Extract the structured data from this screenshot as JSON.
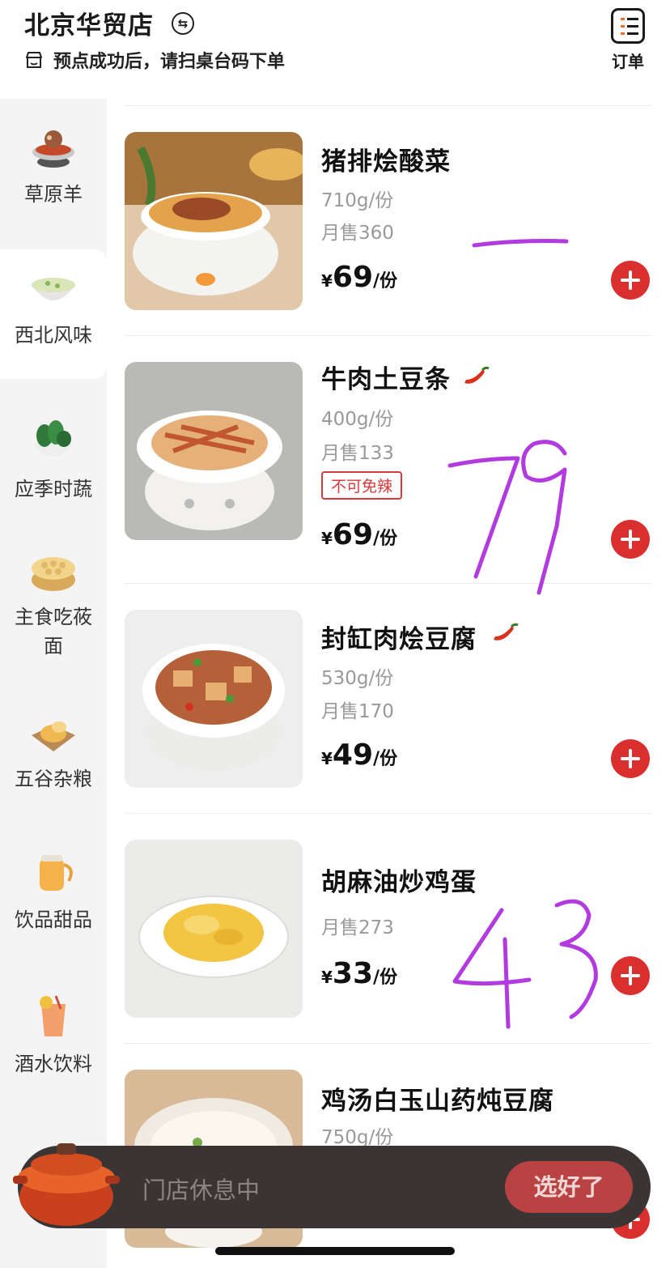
{
  "header": {
    "store_name": "北京华贸店",
    "notice": "预点成功后，请扫桌台码下单",
    "order_label": "订单"
  },
  "sidebar": {
    "items": [
      {
        "label": "草原羊",
        "icon": "lamb-hotpot-icon"
      },
      {
        "label": "西北风味",
        "icon": "soup-bowl-icon",
        "active": true
      },
      {
        "label": "应季时蔬",
        "icon": "vegetable-bowl-icon"
      },
      {
        "label": "主食吃莜面",
        "icon": "steamer-icon"
      },
      {
        "label": "五谷杂粮",
        "icon": "grain-snack-icon"
      },
      {
        "label": "饮品甜品",
        "icon": "teapot-icon"
      },
      {
        "label": "酒水饮料",
        "icon": "juice-cup-icon"
      }
    ]
  },
  "dishes": [
    {
      "name": "猪排烩酸菜",
      "weight": "710g/份",
      "sales": "月售360",
      "currency": "¥",
      "price": "69",
      "unit": "/份",
      "spicy": false
    },
    {
      "name": "牛肉土豆条",
      "weight": "400g/份",
      "sales": "月售133",
      "tag": "不可免辣",
      "currency": "¥",
      "price": "69",
      "unit": "/份",
      "spicy": true
    },
    {
      "name": "封缸肉烩豆腐",
      "weight": "530g/份",
      "sales": "月售170",
      "currency": "¥",
      "price": "49",
      "unit": "/份",
      "spicy": true
    },
    {
      "name": "胡麻油炒鸡蛋",
      "sales": "月售273",
      "currency": "¥",
      "price": "33",
      "unit": "/份",
      "spicy": false
    },
    {
      "name": "鸡汤白玉山药炖豆腐",
      "weight": "750g/份",
      "spicy": false
    }
  ],
  "handwritten_marks": [
    "—",
    "79",
    "43"
  ],
  "cart": {
    "status": "门店休息中",
    "checkout_label": "选好了"
  },
  "colors": {
    "accent_red": "#d92f2f",
    "handwriting_purple": "#b23be0",
    "cart_bg": "#3a3434"
  }
}
